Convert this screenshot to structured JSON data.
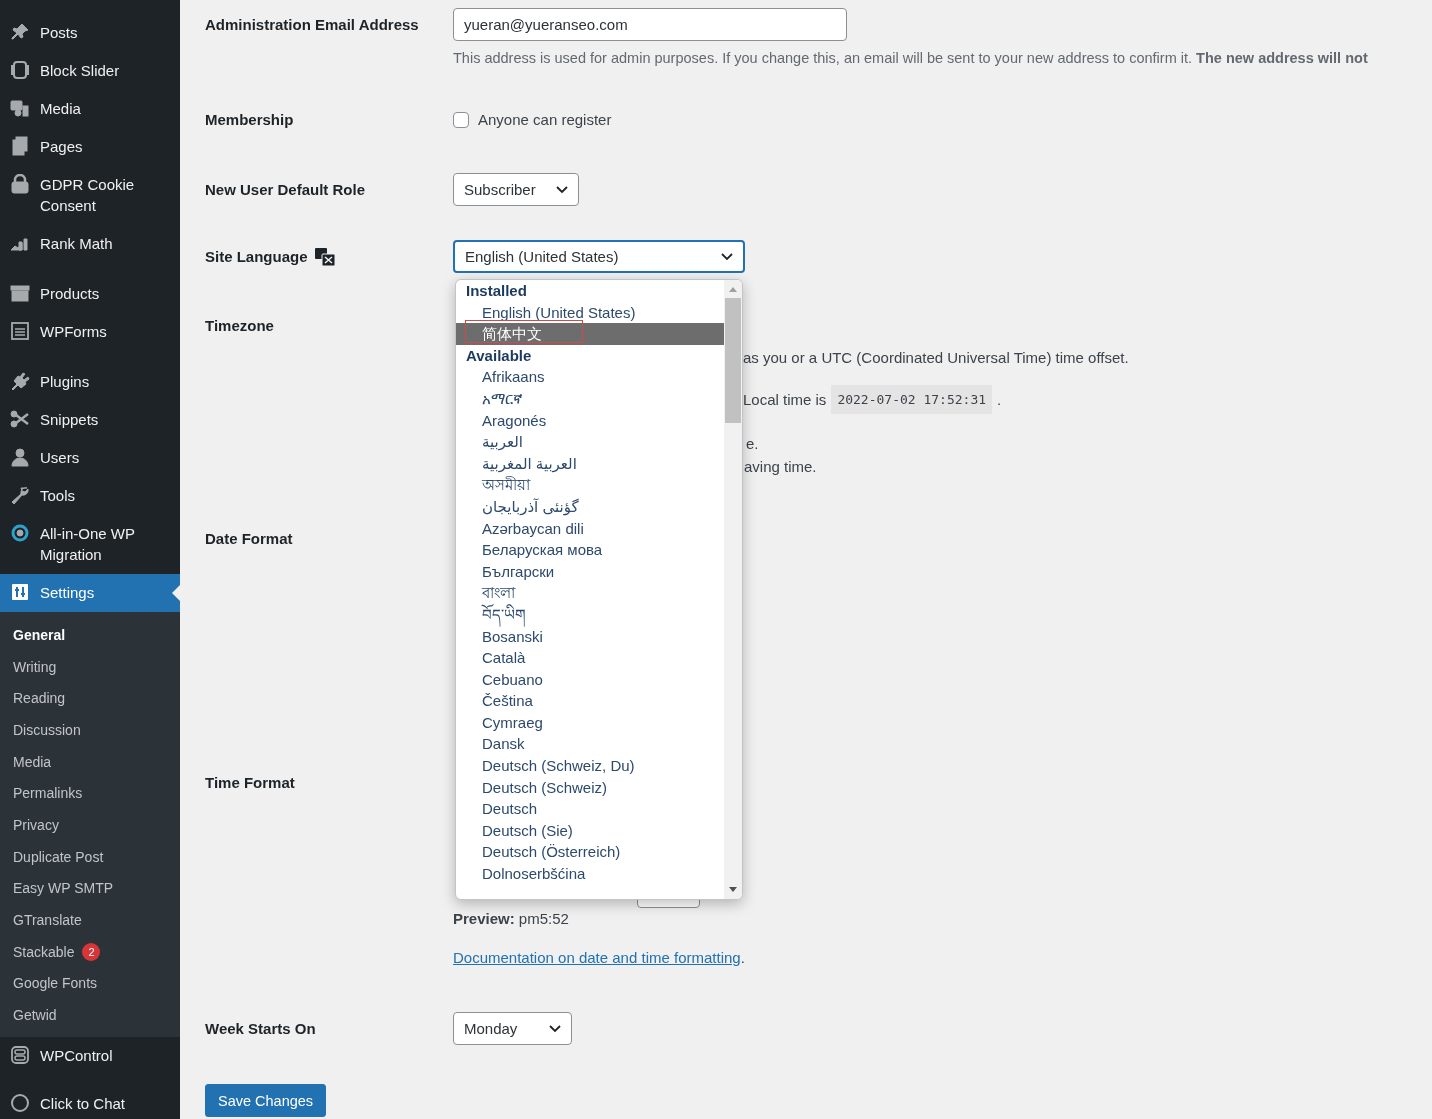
{
  "sidebar": {
    "groups": [
      [
        {
          "label": "Posts",
          "selected": false
        },
        {
          "label": "Block Slider",
          "selected": false
        },
        {
          "label": "Media",
          "selected": false
        },
        {
          "label": "Pages",
          "selected": false
        },
        {
          "label": "GDPR Cookie Consent",
          "selected": false
        },
        {
          "label": "Rank Math",
          "selected": false
        }
      ],
      [
        {
          "label": "Products",
          "selected": false
        },
        {
          "label": "WPForms",
          "selected": false
        }
      ],
      [
        {
          "label": "Plugins",
          "selected": false
        },
        {
          "label": "Snippets",
          "selected": false
        },
        {
          "label": "Users",
          "selected": false
        },
        {
          "label": "Tools",
          "selected": false
        },
        {
          "label": "All-in-One WP Migration",
          "selected": false
        },
        {
          "label": "Settings",
          "selected": true,
          "children": [
            {
              "label": "General",
              "selected": true
            },
            {
              "label": "Writing",
              "selected": false
            },
            {
              "label": "Reading",
              "selected": false
            },
            {
              "label": "Discussion",
              "selected": false
            },
            {
              "label": "Media",
              "selected": false
            },
            {
              "label": "Permalinks",
              "selected": false
            },
            {
              "label": "Privacy",
              "selected": false
            },
            {
              "label": "Duplicate Post",
              "selected": false
            },
            {
              "label": "Easy WP SMTP",
              "selected": false
            },
            {
              "label": "GTranslate",
              "selected": false
            },
            {
              "label": "Stackable",
              "selected": false,
              "badge": "2"
            },
            {
              "label": "Google Fonts",
              "selected": false
            },
            {
              "label": "Getwid",
              "selected": false
            }
          ]
        }
      ],
      [
        {
          "label": "WPControl",
          "selected": false
        },
        {
          "label": "Click to Chat",
          "selected": false
        }
      ]
    ]
  },
  "settings": [
    {
      "kind": "text",
      "label": "Administration Email Address",
      "value": "yueran@yueranseo.com",
      "description": "This address is used for admin purposes. If you change this, an email will be sent to your new address to confirm it. **The new address will not**"
    },
    {
      "kind": "checkbox",
      "label": "Membership",
      "option": "Anyone can register",
      "checked": false
    },
    {
      "kind": "select",
      "label": "New User Default Role",
      "value": "Subscriber"
    },
    {
      "kind": "language",
      "label": "Site Language",
      "value": "English (United States)",
      "open": true,
      "groups": [
        {
          "label": "Installed",
          "options": [
            {
              "label": "English (United States)",
              "selected": false,
              "annotated": false
            },
            {
              "label": "简体中文",
              "selected": true,
              "annotated": true
            }
          ]
        },
        {
          "label": "Available",
          "options": [
            {
              "label": "Afrikaans",
              "selected": false,
              "annotated": false
            },
            {
              "label": "አማርኛ",
              "selected": false,
              "annotated": false
            },
            {
              "label": "Aragonés",
              "selected": false,
              "annotated": false
            },
            {
              "label": "العربية",
              "selected": false,
              "annotated": false
            },
            {
              "label": "العربية المغربية",
              "selected": false,
              "annotated": false
            },
            {
              "label": "অসমীয়া",
              "selected": false,
              "annotated": false
            },
            {
              "label": "گؤنئی آذربایجان",
              "selected": false,
              "annotated": false
            },
            {
              "label": "Azərbaycan dili",
              "selected": false,
              "annotated": false
            },
            {
              "label": "Беларуская мова",
              "selected": false,
              "annotated": false
            },
            {
              "label": "Български",
              "selected": false,
              "annotated": false
            },
            {
              "label": "বাংলা",
              "selected": false,
              "annotated": false
            },
            {
              "label": "བོད་ཡིག",
              "selected": false,
              "annotated": false
            },
            {
              "label": "Bosanski",
              "selected": false,
              "annotated": false
            },
            {
              "label": "Català",
              "selected": false,
              "annotated": false
            },
            {
              "label": "Cebuano",
              "selected": false,
              "annotated": false
            },
            {
              "label": "Čeština",
              "selected": false,
              "annotated": false
            },
            {
              "label": "Cymraeg",
              "selected": false,
              "annotated": false
            },
            {
              "label": "Dansk",
              "selected": false,
              "annotated": false
            },
            {
              "label": "Deutsch (Schweiz, Du)",
              "selected": false,
              "annotated": false
            },
            {
              "label": "Deutsch (Schweiz)",
              "selected": false,
              "annotated": false
            },
            {
              "label": "Deutsch",
              "selected": false,
              "annotated": false
            },
            {
              "label": "Deutsch (Sie)",
              "selected": false,
              "annotated": false
            },
            {
              "label": "Deutsch (Österreich)",
              "selected": false,
              "annotated": false
            },
            {
              "label": "Dolnoserbšćina",
              "selected": false,
              "annotated": false
            }
          ]
        }
      ]
    },
    {
      "kind": "timezone",
      "label": "Timezone",
      "offset_note": "as you or a UTC (Coordinated Universal Time) time offset.",
      "local_time_label": "Local time is",
      "local_time": "2022-07-02 17:52:31",
      "local_time_end": ".",
      "notes": [
        "e.",
        "aving time."
      ]
    },
    {
      "kind": "date_format",
      "label": "Date Format"
    },
    {
      "kind": "time_format",
      "label": "Time Format",
      "preview": "**Preview:** pm5:52",
      "link": "Documentation on date and time formatting",
      "link_end": "."
    },
    {
      "kind": "select",
      "label": "Week Starts On",
      "value": "Monday"
    }
  ],
  "save_button": "Save Changes"
}
